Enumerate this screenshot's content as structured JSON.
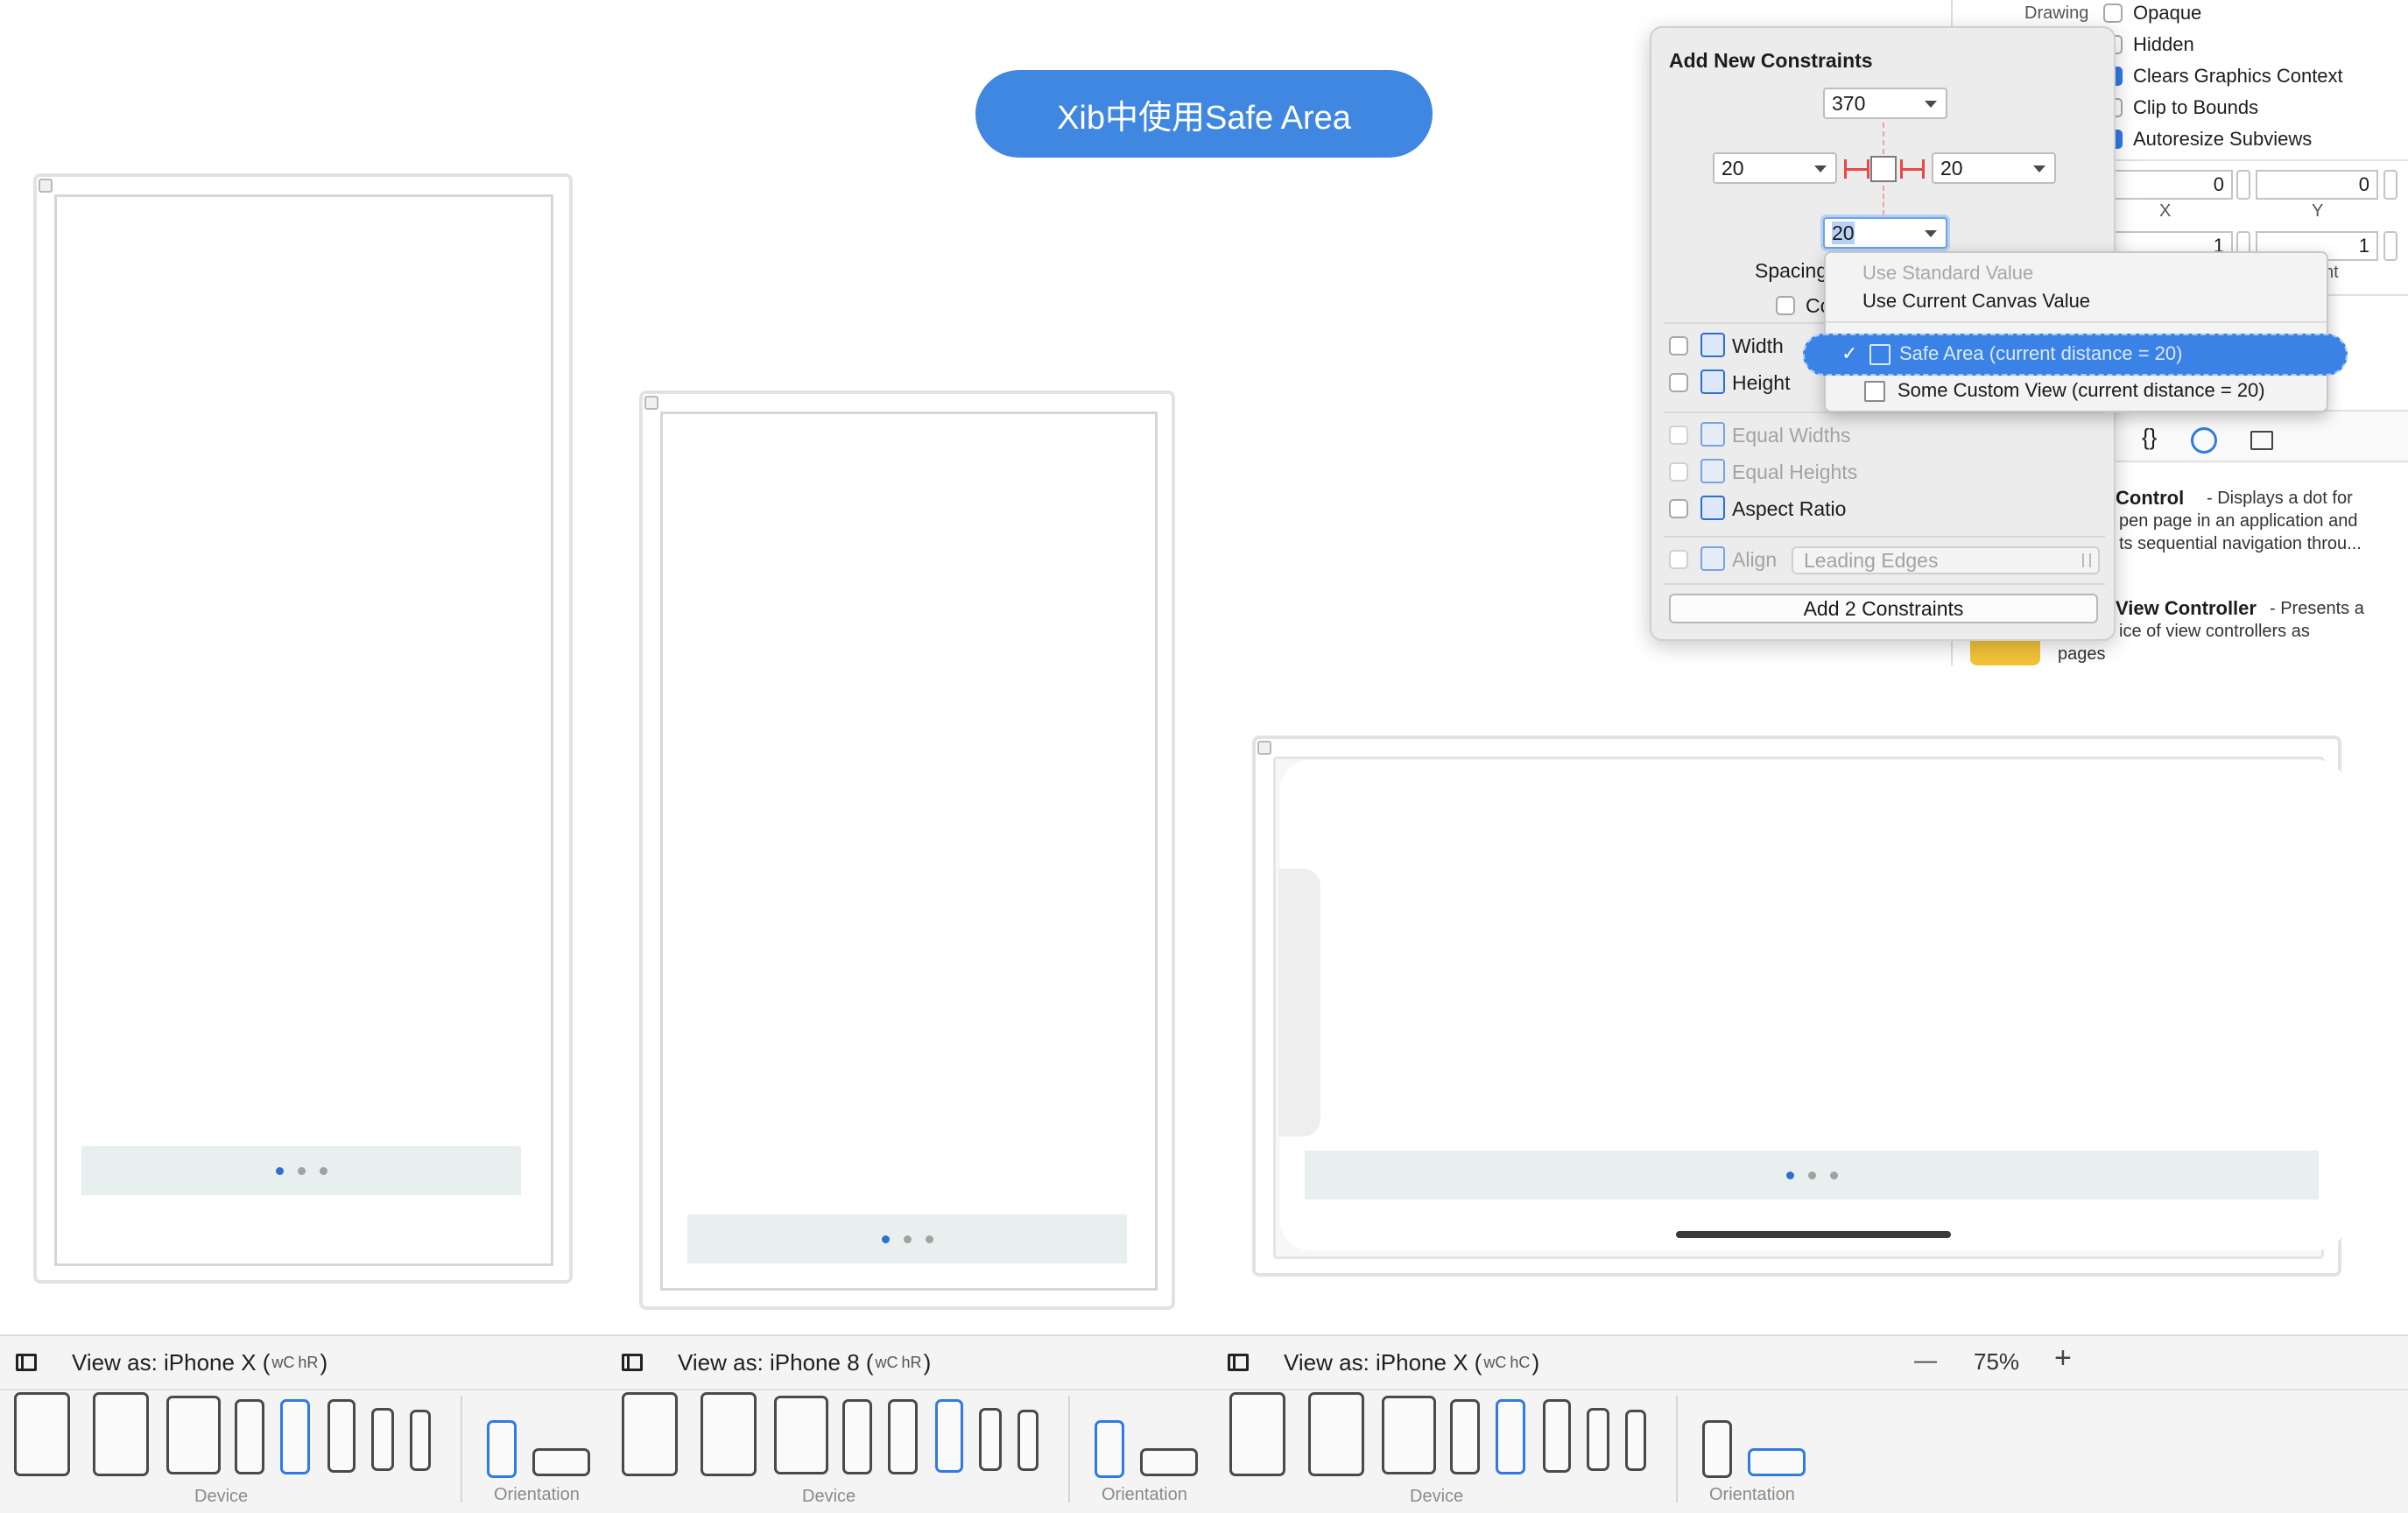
{
  "title": "Xib中使用Safe Area",
  "popover": {
    "heading": "Add New Constraints",
    "top_value": "370",
    "left_value": "20",
    "right_value": "20",
    "bottom_value": "20",
    "spacing_label": "Spacing",
    "constrain_label": "Co",
    "width_label": "Width",
    "height_label": "Height",
    "equal_widths_label": "Equal Widths",
    "equal_heights_label": "Equal Heights",
    "aspect_ratio_label": "Aspect Ratio",
    "align_label": "Align",
    "align_value": "Leading Edges",
    "add_button_label": "Add 2 Constraints"
  },
  "menu": {
    "use_standard": "Use Standard Value",
    "use_canvas": "Use Current Canvas Value",
    "safe_area": "Safe Area (current distance = 20)",
    "custom_view": "Some Custom View (current distance = 20)",
    "check": "✓"
  },
  "inspector": {
    "drawing_label": "Drawing",
    "opaque": "Opaque",
    "hidden": "Hidden",
    "clears_graphics": "Clears Graphics Context",
    "clip_to_bounds": "Clip to Bounds",
    "autoresize": "Autoresize Subviews",
    "x_value": "0",
    "y_value": "0",
    "x_label": "X",
    "y_label": "Y",
    "w_value": "1",
    "h_value": "1",
    "ht_label": "ht",
    "braces": "{}",
    "page_control_title": "Control",
    "page_control_desc1": "- Displays a dot for",
    "page_control_desc2": "pen page in an application and",
    "page_control_desc3": "ts sequential navigation throu...",
    "pvc_title": "View Controller",
    "pvc_desc1": "- Presents a",
    "pvc_desc2": "ice of view controllers as",
    "pvc_desc3": "pages"
  },
  "bottom": {
    "view_as": [
      {
        "device": "View as: iPhone X (",
        "w": "wC",
        "h": "hR",
        "close": ")"
      },
      {
        "device": "View as: iPhone 8 (",
        "w": "wC",
        "h": "hR",
        "close": ")"
      },
      {
        "device": "View as: iPhone X (",
        "w": "wC",
        "h": "hC",
        "close": ")"
      }
    ],
    "zoom_out": "—",
    "zoom": "75%",
    "zoom_in": "+",
    "device_label": "Device",
    "orientation_label": "Orientation"
  },
  "accent_color": "#3f87e0"
}
